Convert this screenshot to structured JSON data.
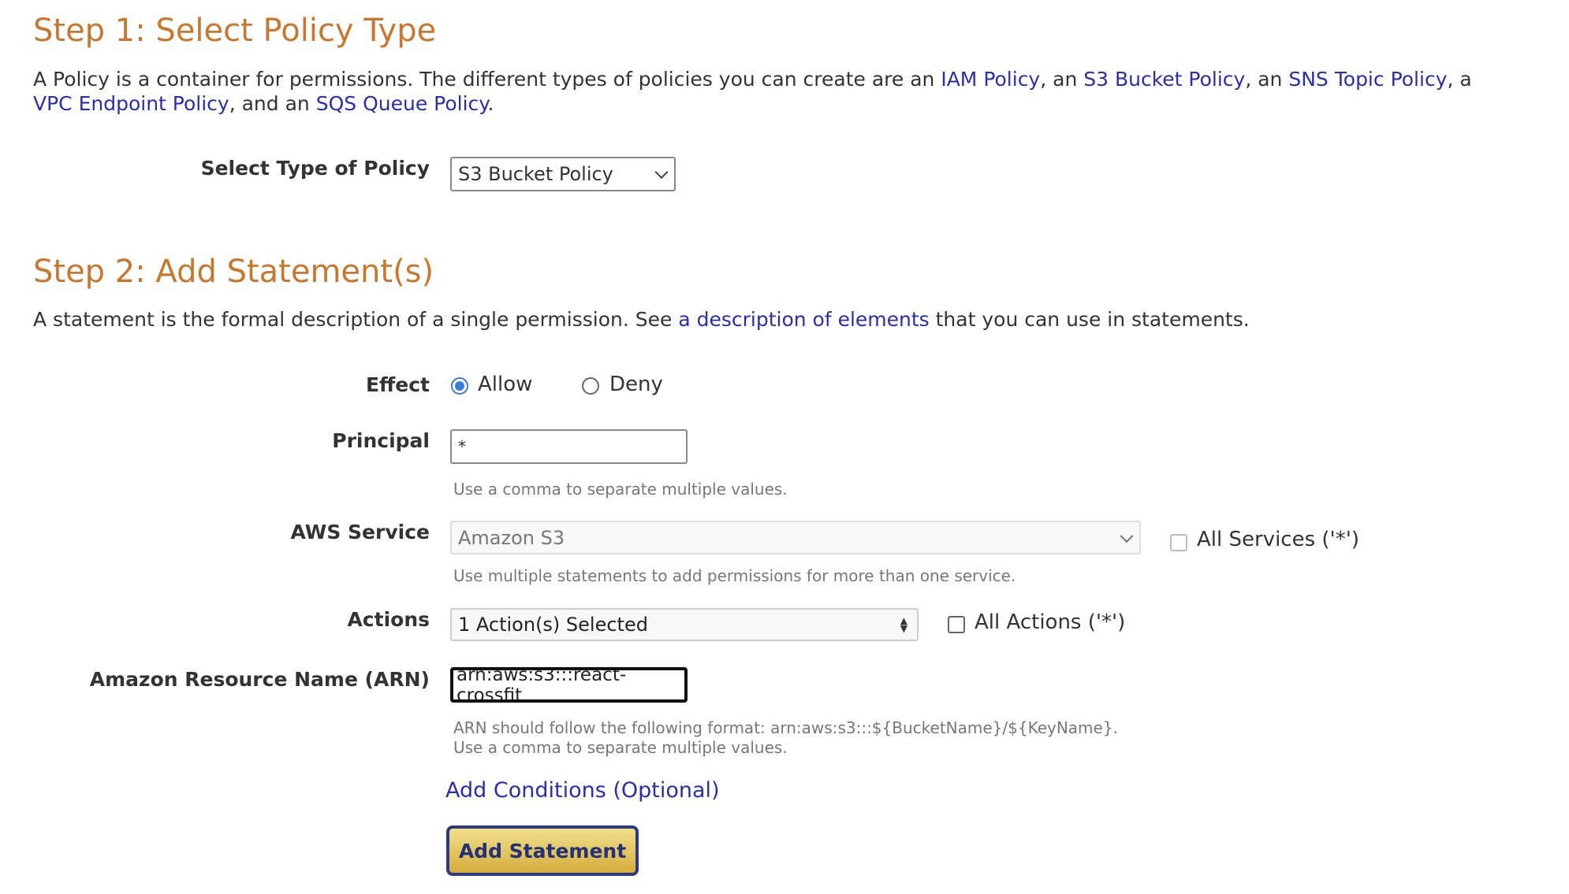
{
  "step1": {
    "title": "Step 1: Select Policy Type",
    "desc_parts": [
      "A Policy is a container for permissions. The different types of policies you can create are an ",
      ", an ",
      ", an ",
      ", a",
      ", and an ",
      "."
    ],
    "links": [
      "IAM Policy",
      "S3 Bucket Policy",
      "SNS Topic Policy",
      "VPC Endpoint Policy",
      "SQS Queue Policy"
    ],
    "select_label": "Select Type of Policy",
    "select_value": "S3 Bucket Policy"
  },
  "step2": {
    "title": "Step 2: Add Statement(s)",
    "desc_before": "A statement is the formal description of a single permission. See ",
    "desc_link": "a description of elements",
    "desc_after": " that you can use in statements.",
    "effect": {
      "label": "Effect",
      "options": [
        "Allow",
        "Deny"
      ],
      "selected": "Allow"
    },
    "principal": {
      "label": "Principal",
      "value": "*",
      "help": "Use a comma to separate multiple values."
    },
    "service": {
      "label": "AWS Service",
      "value": "Amazon S3",
      "all_label": "All Services ('*')",
      "help": "Use multiple statements to add permissions for more than one service."
    },
    "actions": {
      "label": "Actions",
      "value": "1 Action(s) Selected",
      "all_label": "All Actions ('*')"
    },
    "arn": {
      "label": "Amazon Resource Name (ARN)",
      "value": "arn:aws:s3:::react-crossfit",
      "help1": "ARN should follow the following format: arn:aws:s3:::${BucketName}/${KeyName}.",
      "help2": "Use a comma to separate multiple values."
    },
    "conditions_link": "Add Conditions (Optional)",
    "add_button": "Add Statement"
  },
  "colors": {
    "heading": "#c7782f",
    "link": "#2a2fa8",
    "button": "#e2bf55",
    "radio": "#3b7ddd"
  }
}
